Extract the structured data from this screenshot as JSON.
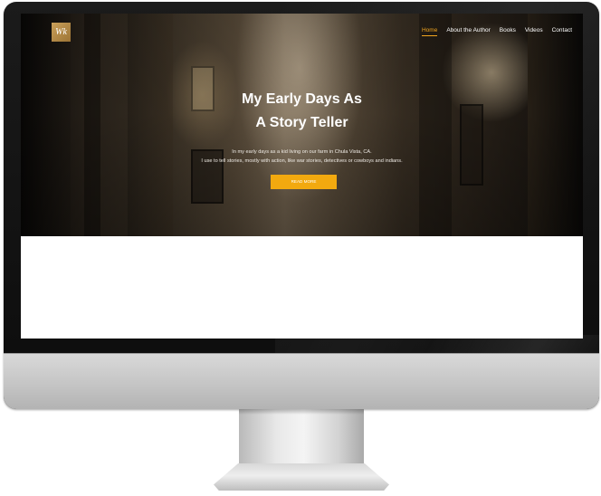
{
  "site": {
    "logo_text": "Wk"
  },
  "nav": {
    "items": [
      {
        "label": "Home",
        "active": true
      },
      {
        "label": "About the Author",
        "active": false
      },
      {
        "label": "Books",
        "active": false
      },
      {
        "label": "Videos",
        "active": false
      },
      {
        "label": "Contact",
        "active": false
      }
    ]
  },
  "hero": {
    "title_line1": "My Early Days As",
    "title_line2": "A Story Teller",
    "text_line1": "In my early days as a kid living on our farm in Chula Vista, CA.",
    "text_line2": "I use to tell stories, mostly with action, like war stories, detectives or cowboys and indians.",
    "button_label": "READ MORE"
  },
  "colors": {
    "accent": "#f2a90f",
    "nav_active": "#f2a51f",
    "monitor_bezel": "#111111",
    "monitor_chin": "#c8c8c8"
  }
}
